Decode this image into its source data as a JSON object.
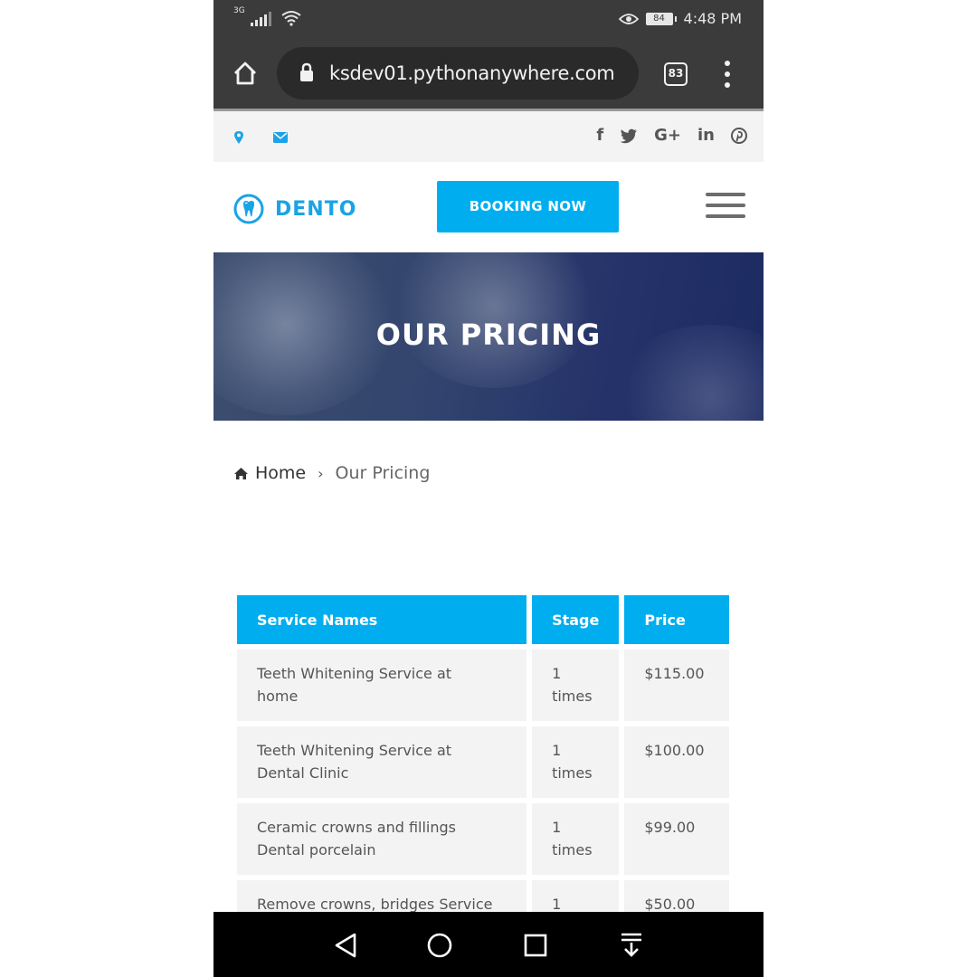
{
  "status_bar": {
    "network": "3G",
    "battery": "84",
    "time": "4:48 PM"
  },
  "browser": {
    "url": "ksdev01.pythonanywhere.com",
    "tab_count": "83"
  },
  "info_bar": {
    "social_facebook": "f",
    "social_twitter": "ᴛ",
    "social_google": "G+",
    "social_linkedin": "in",
    "social_pinterest": "ⓟ"
  },
  "header": {
    "logo_text": "DENTO",
    "booking_label": "BOOKING NOW"
  },
  "hero": {
    "title": "OUR PRICING"
  },
  "breadcrumb": {
    "home": "Home",
    "separator": "›",
    "current": "Our Pricing"
  },
  "pricing": {
    "headers": [
      "Service Names",
      "Stage",
      "Price"
    ],
    "rows": [
      {
        "service_line1": "Teeth Whitening Service at",
        "service_line2": "home",
        "stage_line1": "1",
        "stage_line2": "times",
        "price": "$115.00"
      },
      {
        "service_line1": "Teeth Whitening Service at",
        "service_line2": "Dental Clinic",
        "stage_line1": "1",
        "stage_line2": "times",
        "price": "$100.00"
      },
      {
        "service_line1": "Ceramic crowns and fillings",
        "service_line2": "Dental porcelain",
        "stage_line1": "1",
        "stage_line2": "times",
        "price": "$99.00"
      },
      {
        "service_line1": "Remove crowns, bridges Service",
        "service_line2": "",
        "stage_line1": "1",
        "stage_line2": "",
        "price": "$50.00"
      }
    ]
  },
  "colors": {
    "accent": "#00aeef",
    "logo": "#1aa3e6",
    "cell_bg": "#f3f3f3",
    "status_bar": "#3b3b3b"
  },
  "icons": [
    "wifi-icon",
    "eye-icon",
    "battery-icon",
    "home-icon",
    "lock-icon",
    "tabs-icon",
    "more-icon",
    "map-pin-icon",
    "mail-icon",
    "facebook-icon",
    "twitter-icon",
    "google-plus-icon",
    "linkedin-icon",
    "pinterest-icon",
    "tooth-logo-icon",
    "hamburger-icon",
    "home-crumb-icon",
    "nav-back-icon",
    "nav-home-icon",
    "nav-recent-icon",
    "nav-down-icon"
  ]
}
